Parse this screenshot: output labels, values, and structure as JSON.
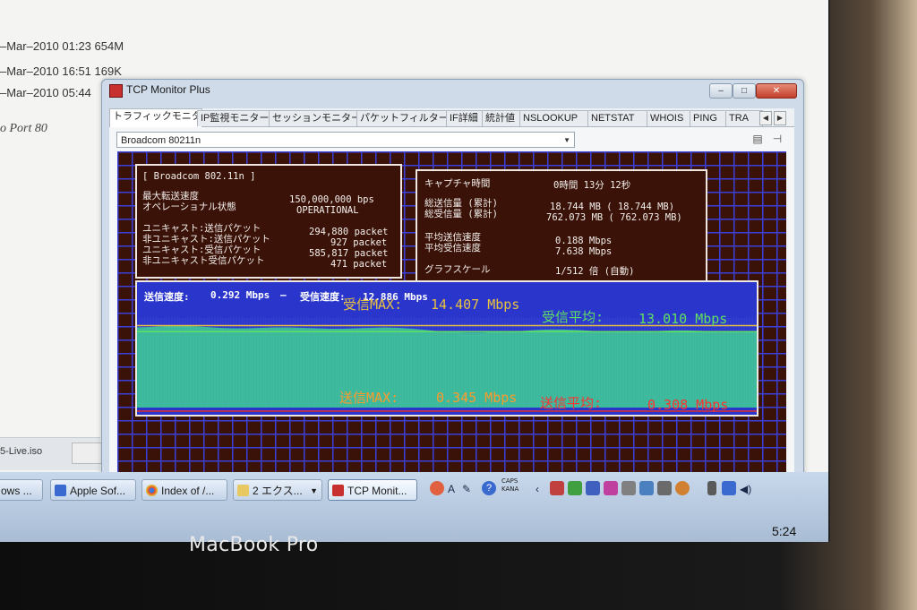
{
  "background_doc": {
    "lines": [
      "–Mar–2010 01:23 654M",
      "–Mar–2010 16:51 169K",
      "–Mar–2010 05:44"
    ],
    "port_text": "o Port 80",
    "iso_label": "5-Live.iso"
  },
  "window": {
    "title": "TCP Monitor Plus",
    "tabs": [
      "トラフィックモニター",
      "IP監視モニター",
      "セッションモニター",
      "パケットフィルター",
      "IF詳細",
      "統計値",
      "NSLOOKUP",
      "NETSTAT",
      "WHOIS",
      "PING",
      "TRA"
    ],
    "adapter_select": "Broadcom 80211n"
  },
  "adapter_box": {
    "name": "[ Broadcom 802.11n ]",
    "rows": [
      {
        "label": "最大転送速度",
        "value": "150,000,000 bps"
      },
      {
        "label": "オペレーショナル状態",
        "value": "OPERATIONAL"
      },
      {
        "label": "ユニキャスト:送信パケット",
        "value": "294,880 packet"
      },
      {
        "label": "非ユニキャスト:送信パケット",
        "value": "927 packet"
      },
      {
        "label": "ユニキャスト:受信パケット",
        "value": "585,817 packet"
      },
      {
        "label": "非ユニキャスト受信パケット",
        "value": "471 packet"
      }
    ]
  },
  "stats_box": {
    "capture_label": "キャプチャ時間",
    "capture_value": "0時間 13分 12秒",
    "sent_total_label": "総送信量 (累計)",
    "sent_total_value": "18.744 MB ( 18.744 MB)",
    "recv_total_label": "総受信量 (累計)",
    "recv_total_value": "762.073 MB ( 762.073 MB)",
    "avg_send_label": "平均送信速度",
    "avg_send_value": "0.188 Mbps",
    "avg_recv_label": "平均受信速度",
    "avg_recv_value": "7.638 Mbps",
    "scale_label": "グラフスケール",
    "scale_value": "1/512 倍 (自動)"
  },
  "graph": {
    "send_speed_label": "送信速度:",
    "send_speed_value": "0.292 Mbps",
    "separator": "–",
    "recv_speed_label": "受信速度:",
    "recv_speed_value": "12.886 Mbps",
    "recv_max_label": "受信MAX:",
    "recv_max_value": "14.407 Mbps",
    "recv_avg_label": "受信平均:",
    "recv_avg_value": "13.010 Mbps",
    "send_max_label": "送信MAX:",
    "send_max_value": "0.345 Mbps",
    "send_avg_label": "送信平均:",
    "send_avg_value": "0.308 Mbps",
    "colors": {
      "area": "#3ab89a",
      "recv_max_line": "#e8c040",
      "recv_avg_line": "#60e060",
      "send_line": "#e03030",
      "bg": "#2a35cc"
    }
  },
  "chart_data": {
    "type": "area",
    "series": [
      {
        "values": [
          14.0,
          14.1,
          14.3,
          14.4,
          14.3,
          14.1,
          13.9,
          13.8,
          13.8,
          13.9,
          14.0,
          14.0,
          13.9,
          13.8,
          13.7,
          13.7,
          13.8,
          13.9,
          14.0,
          13.9,
          13.7,
          13.4,
          13.1,
          12.9,
          12.8,
          12.8,
          12.9,
          13.0,
          13.2,
          13.4,
          13.5,
          13.5,
          13.4,
          13.2,
          13.0,
          12.9,
          12.9,
          13.0,
          13.2,
          13.3,
          13.3,
          13.2,
          13.0,
          12.9,
          12.9,
          13.0
        ]
      }
    ],
    "ylim": [
      0,
      14.407
    ]
  },
  "taskbar": {
    "buttons": [
      "ows ...",
      "Apple Sof...",
      "Index of /...",
      "2 エクス...",
      "TCP Monit..."
    ],
    "caps_label": "CAPS",
    "kana_label": "KANA",
    "clock": "5:24"
  },
  "bezel_label": "MacBook Pro"
}
